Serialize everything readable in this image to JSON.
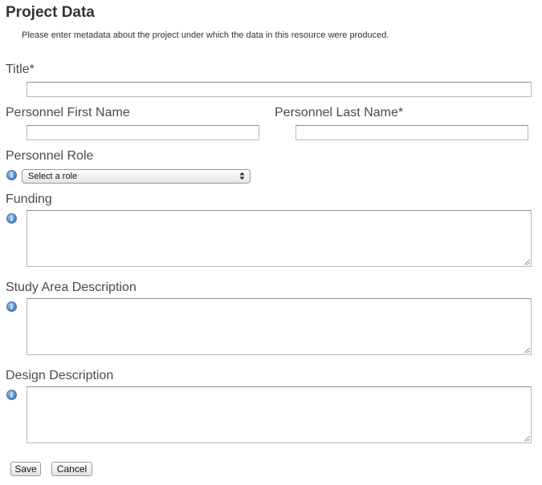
{
  "header": {
    "title": "Project Data",
    "intro": "Please enter metadata about the project under which the data in this resource were produced."
  },
  "form": {
    "title_label": "Title*",
    "title_value": "",
    "first_name_label": "Personnel First Name",
    "first_name_value": "",
    "last_name_label": "Personnel Last Name*",
    "last_name_value": "",
    "role_label": "Personnel Role",
    "role_selected": "Select a role",
    "funding_label": "Funding",
    "funding_value": "",
    "study_area_label": "Study Area Description",
    "study_area_value": "",
    "design_label": "Design Description",
    "design_value": ""
  },
  "actions": {
    "save_label": "Save",
    "cancel_label": "Cancel"
  },
  "icons": {
    "info": "info-icon",
    "select_arrows": "updown-arrows-icon",
    "resize": "resize-grip-icon"
  },
  "colors": {
    "info_icon": "#4a7fbf",
    "label_text": "#4a4a4a",
    "border": "#b9b9b9"
  }
}
